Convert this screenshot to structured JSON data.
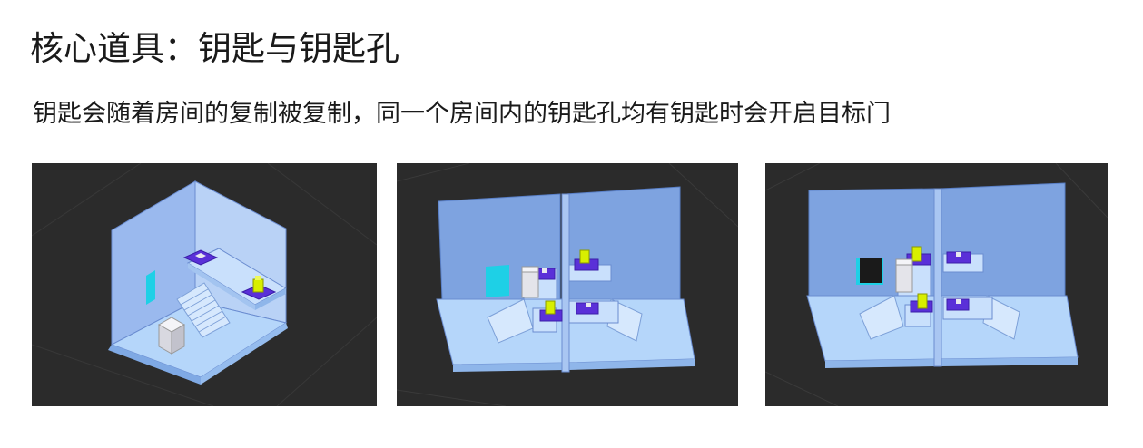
{
  "slide": {
    "title": "核心道具：钥匙与钥匙孔",
    "subtitle": "钥匙会随着房间的复制被复制，同一个房间内的钥匙孔均有钥匙时会开启目标门"
  },
  "screenshots": [
    {
      "caption": ""
    },
    {
      "caption": ""
    },
    {
      "caption": ""
    }
  ],
  "colors": {
    "background": "#2b2b2b",
    "wall_dark": "#7ea3e0",
    "wall_light": "#a9c6f2",
    "floor": "#b5d6fa",
    "door": "#1ed0e6",
    "keyhole": "#5a30d8",
    "key": "#d8ef00",
    "block": "#e4e4ea"
  }
}
